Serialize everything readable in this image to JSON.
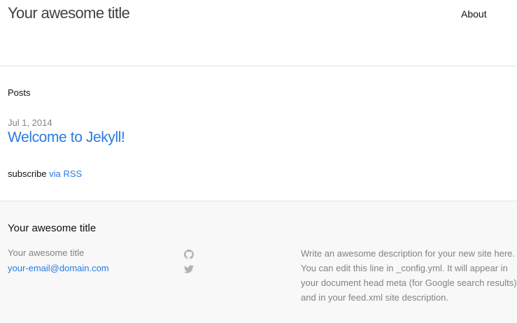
{
  "header": {
    "site_title": "Your awesome title",
    "nav": [
      {
        "label": "About"
      }
    ]
  },
  "main": {
    "posts_heading": "Posts",
    "posts": [
      {
        "date": "Jul 1, 2014",
        "title": "Welcome to Jekyll!"
      }
    ],
    "subscribe_text": "subscribe",
    "rss_link": "via RSS"
  },
  "footer": {
    "heading": "Your awesome title",
    "name": "Your awesome title",
    "email": "your-email@domain.com",
    "social_icons": [
      "github-icon",
      "twitter-icon"
    ],
    "description": "Write an awesome description for your new site here. You can edit this line in _config.yml. It will appear in your document head meta (for Google search results) and in your feed.xml site description."
  },
  "colors": {
    "link": "#2a7ae2",
    "muted_text": "#828282",
    "body_text": "#111111",
    "footer_bg": "#f8f8f8",
    "border": "#e2e2e2"
  }
}
